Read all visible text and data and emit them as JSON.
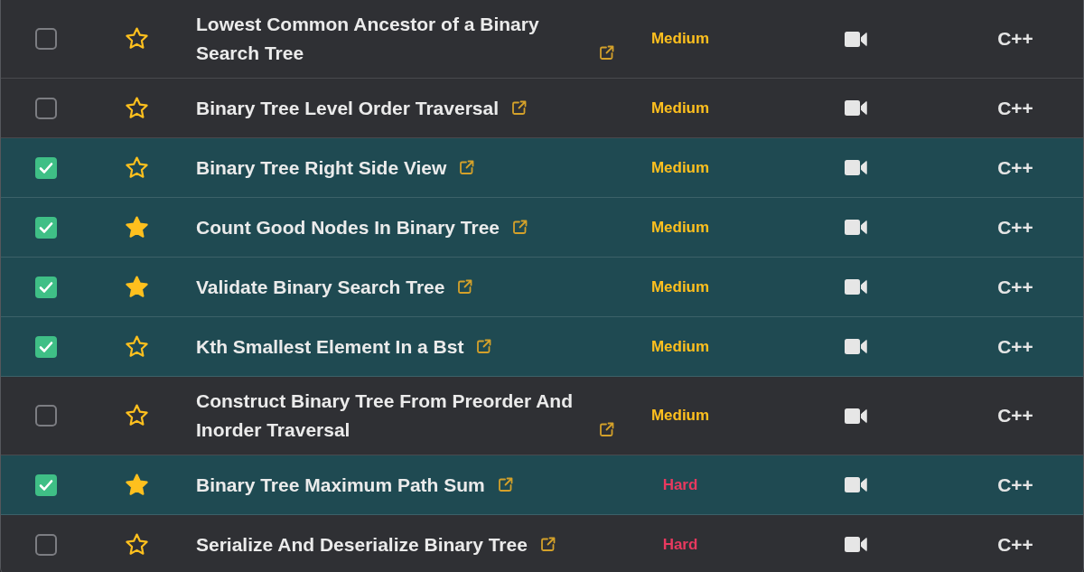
{
  "problems": [
    {
      "checked": false,
      "starred": false,
      "title": "Lowest Common Ancestor of a Binary Search Tree",
      "difficulty": {
        "text": "Medium",
        "color": "#ffc01e"
      },
      "language": "C++"
    },
    {
      "checked": false,
      "starred": false,
      "title": "Binary Tree Level Order Traversal",
      "difficulty": {
        "text": "Medium",
        "color": "#ffc01e"
      },
      "language": "C++"
    },
    {
      "checked": true,
      "starred": false,
      "title": "Binary Tree Right Side View",
      "difficulty": {
        "text": "Medium",
        "color": "#ffc01e"
      },
      "language": "C++"
    },
    {
      "checked": true,
      "starred": true,
      "title": "Count Good Nodes In Binary Tree",
      "difficulty": {
        "text": "Medium",
        "color": "#ffc01e"
      },
      "language": "C++"
    },
    {
      "checked": true,
      "starred": true,
      "title": "Validate Binary Search Tree",
      "difficulty": {
        "text": "Medium",
        "color": "#ffc01e"
      },
      "language": "C++"
    },
    {
      "checked": true,
      "starred": false,
      "title": "Kth Smallest Element In a Bst",
      "difficulty": {
        "text": "Medium",
        "color": "#ffc01e"
      },
      "language": "C++"
    },
    {
      "checked": false,
      "starred": false,
      "title": "Construct Binary Tree From Preorder And Inorder Traversal",
      "difficulty": {
        "text": "Medium",
        "color": "#ffc01e"
      },
      "language": "C++"
    },
    {
      "checked": true,
      "starred": true,
      "title": "Binary Tree Maximum Path Sum",
      "difficulty": {
        "text": "Hard",
        "color": "#e8395f"
      },
      "language": "C++"
    },
    {
      "checked": false,
      "starred": false,
      "title": "Serialize And Deserialize Binary Tree",
      "difficulty": {
        "text": "Hard",
        "color": "#e8395f"
      },
      "language": "C++"
    }
  ]
}
